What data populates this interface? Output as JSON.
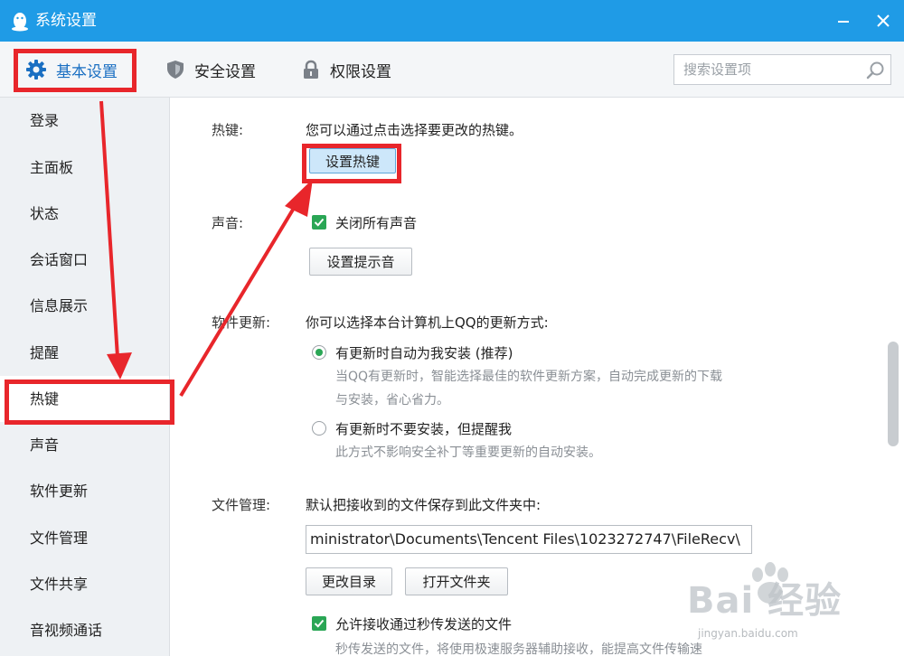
{
  "window": {
    "title": "系统设置"
  },
  "tabs": [
    {
      "label": "基本设置"
    },
    {
      "label": "安全设置"
    },
    {
      "label": "权限设置"
    }
  ],
  "search": {
    "placeholder": "搜索设置项"
  },
  "sidebar": {
    "items": [
      {
        "label": "登录"
      },
      {
        "label": "主面板"
      },
      {
        "label": "状态"
      },
      {
        "label": "会话窗口"
      },
      {
        "label": "信息展示"
      },
      {
        "label": "提醒"
      },
      {
        "label": "热键"
      },
      {
        "label": "声音"
      },
      {
        "label": "软件更新"
      },
      {
        "label": "文件管理"
      },
      {
        "label": "文件共享"
      },
      {
        "label": "音视频通话"
      }
    ]
  },
  "hotkey": {
    "label": "热键:",
    "desc": "您可以通过点击选择要更改的热键。",
    "button": "设置热键"
  },
  "sound": {
    "label": "声音:",
    "checkbox": "关闭所有声音",
    "button": "设置提示音"
  },
  "update": {
    "label": "软件更新:",
    "desc": "你可以选择本台计算机上QQ的更新方式:",
    "option1": "有更新时自动为我安装 (推荐)",
    "option1_desc_1": "当QQ有更新时，智能选择最佳的软件更新方案，自动完成更新的下载",
    "option1_desc_2": "与安装，省心省力。",
    "option2": "有更新时不要安装，但提醒我",
    "option2_desc": "此方式不影响安全补丁等重要更新的自动安装。"
  },
  "file": {
    "label": "文件管理:",
    "desc": "默认把接收到的文件保存到此文件夹中:",
    "path": "ministrator\\Documents\\Tencent Files\\1023272747\\FileRecv\\",
    "change_button": "更改目录",
    "open_button": "打开文件夹",
    "checkbox": "允许接收通过秒传发送的文件",
    "checkbox_desc": "秒传发送的文件，将使用极速服务器辅助接收，能提高文件传输速"
  },
  "watermark": {
    "brand": "Bai 经验",
    "url": "jingyan.baidu.com"
  },
  "colors": {
    "titlebar": "#1f9be6",
    "highlight": "#e8262b",
    "check": "#2aa655"
  }
}
